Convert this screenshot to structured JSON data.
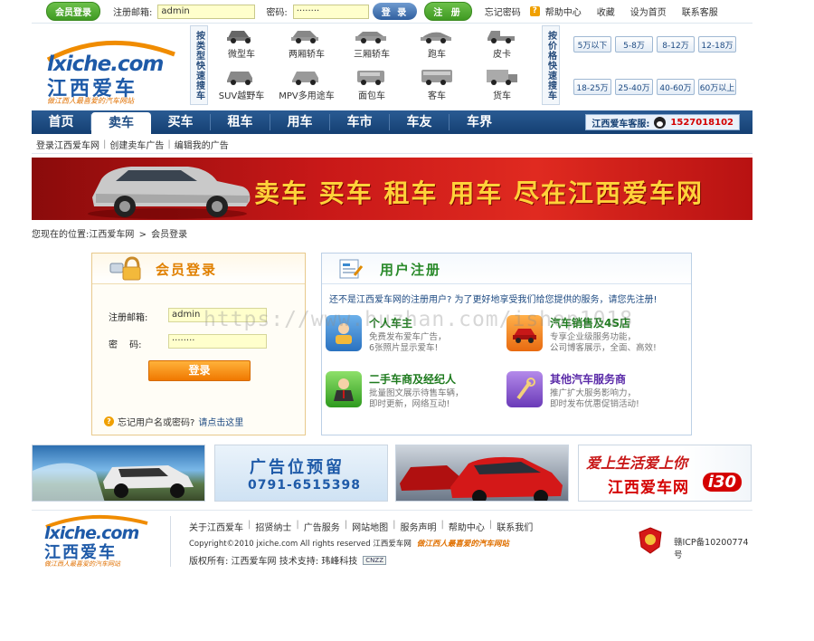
{
  "topbar": {
    "member_login": "会员登录",
    "email_label": "注册邮箱:",
    "email_value": "admin",
    "password_label": "密码:",
    "password_value": "········",
    "login_button": "登 录",
    "register_button": "注 册",
    "links": [
      "忘记密码",
      "帮助中心",
      "收藏",
      "设为首页",
      "联系客服"
    ]
  },
  "logo": {
    "domain": "lxiche.com",
    "name": "江西爱车",
    "slogan": "做江西人最喜爱的汽车网站"
  },
  "quick_type": {
    "label": "按类型快速搜车",
    "cars": [
      "微型车",
      "两厢轿车",
      "三厢轿车",
      "跑车",
      "皮卡",
      "SUV越野车",
      "MPV多用途车",
      "面包车",
      "客车",
      "货车"
    ]
  },
  "quick_price": {
    "label": "按价格快速搜车",
    "prices": [
      "5万以下",
      "5-8万",
      "8-12万",
      "12-18万",
      "18-25万",
      "25-40万",
      "40-60万",
      "60万以上"
    ]
  },
  "nav": {
    "items": [
      "首页",
      "卖车",
      "买车",
      "租车",
      "用车",
      "车市",
      "车友",
      "车界"
    ],
    "active": "卖车",
    "service_label": "江西爱车客服:",
    "service_phone": "1527018102"
  },
  "subnav": {
    "links": [
      "登录江西爱车网",
      "创建卖车广告",
      "编辑我的广告"
    ]
  },
  "banner": {
    "text": "卖车 买车 租车 用车 尽在江西爱车网"
  },
  "breadcrumb": {
    "prefix": "您现在的位置:",
    "home": "江西爱车网",
    "sep": ">",
    "current": "会员登录"
  },
  "login": {
    "title": "会员登录",
    "email_label": "注册邮箱:",
    "email_value": "admin",
    "password_label": "密　 码:",
    "password_value": "········",
    "button": "登录",
    "forgot_text": "忘记用户名或密码?",
    "forgot_link": "请点击这里"
  },
  "register": {
    "title": "用户注册",
    "intro": "还不是江西爱车网的注册用户? 为了更好地享受我们给您提供的服务，请您先注册!",
    "services": [
      {
        "title": "个人车主",
        "desc1": "免费发布爱车广告，",
        "desc2": "6张照片显示爱车!"
      },
      {
        "title": "汽车销售及4S店",
        "desc1": "专享企业级服务功能，",
        "desc2": "公司博客展示，全面、高效!"
      },
      {
        "title": "二手车商及经纪人",
        "desc1": "批量图文展示待售车辆，",
        "desc2": "即时更新，网络互动!"
      },
      {
        "title": "其他汽车服务商",
        "desc1": "推广扩大服务影响力，",
        "desc2": "即时发布优惠促销活动!"
      }
    ]
  },
  "watermark": "https://www.huzhan.com/ishop1018",
  "ads": {
    "reserve_title": "广告位预留",
    "reserve_phone": "0791-6515398",
    "promo_line1": "爱上生活爱上你",
    "promo_line2": "江西爱车网",
    "promo_tag": "i30"
  },
  "footer": {
    "links": [
      "关于江西爱车",
      "招贤纳士",
      "广告服务",
      "网站地图",
      "服务声明",
      "帮助中心",
      "联系我们"
    ],
    "copyright": "Copyright©2010 jxiche.com All rights reserved 江西爱车网",
    "slogan": "做江西人最喜爱的汽车网站",
    "owner": "版权所有: 江西爱车网 技术支持: 玮峰科技",
    "cnzz": "CNZZ",
    "icp": "赣ICP备10200774号"
  },
  "colors": {
    "nav_blue": "#1e4c83",
    "accent_orange": "#f07800",
    "accent_green": "#3f9a22",
    "banner_red": "#c81818",
    "banner_gold": "#ffd23a"
  }
}
